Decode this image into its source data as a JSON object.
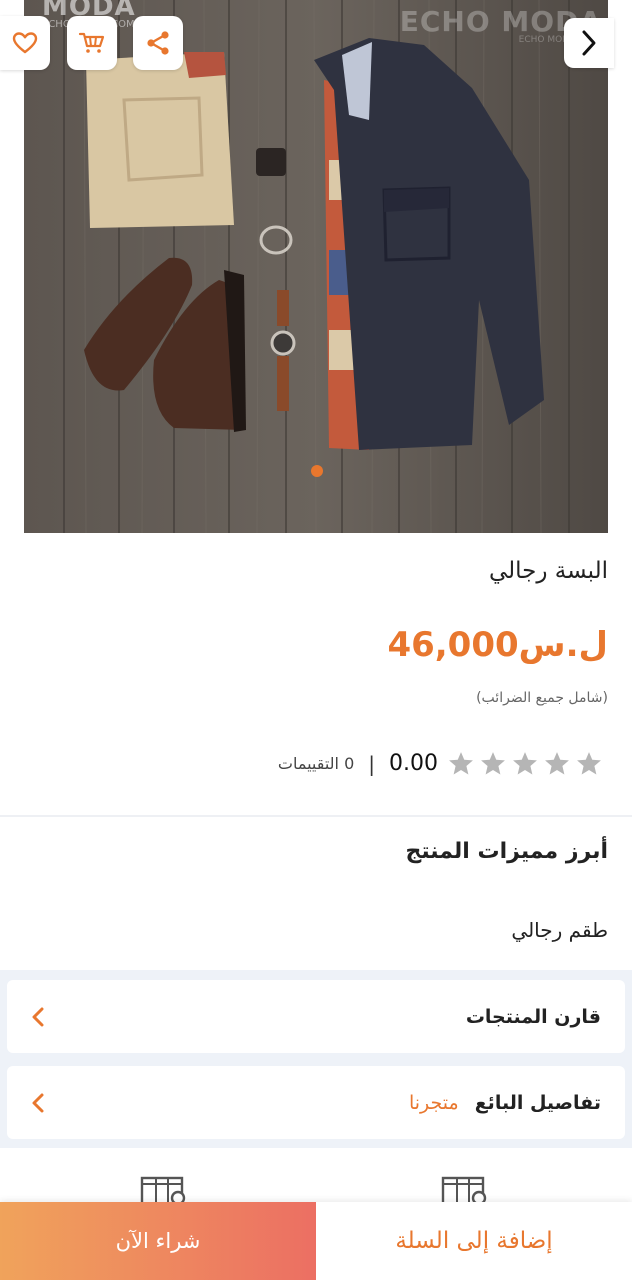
{
  "gallery": {
    "watermark_left_title": "MODA",
    "watermark_left_sub": "ECHO MODA .COM",
    "watermark_right_title": "ECHO MODA",
    "watermark_right_sub": "ECHO MODA .COM",
    "active_index": 0,
    "icons": {
      "favorite": "heart-icon",
      "cart": "cart-icon",
      "share": "share-icon",
      "next": "chevron-right-icon"
    }
  },
  "product": {
    "title": "البسة رجالي",
    "price": "ل.س46,000",
    "tax_note": "(شامل جميع الضرائب)",
    "rating": {
      "stars_filled": 0,
      "stars_total": 5,
      "value": "0.00",
      "separator": "|",
      "count_label": "0 التقييمات"
    }
  },
  "features": {
    "heading": "أبرز مميزات المنتج",
    "text": "طقم رجالي"
  },
  "cards": {
    "compare_label": "قارن المنتجات",
    "seller_label": "تفاصيل البائع",
    "seller_name": "متجرنا"
  },
  "actions": {
    "buy_now": "شراء الآن",
    "add_to_cart": "إضافة إلى السلة"
  },
  "colors": {
    "accent": "#e8772e",
    "star_empty": "#b5b5b5",
    "gradient_start": "#f0a35b",
    "gradient_end": "#ec6f63",
    "gray_bg": "#eef2f8"
  }
}
